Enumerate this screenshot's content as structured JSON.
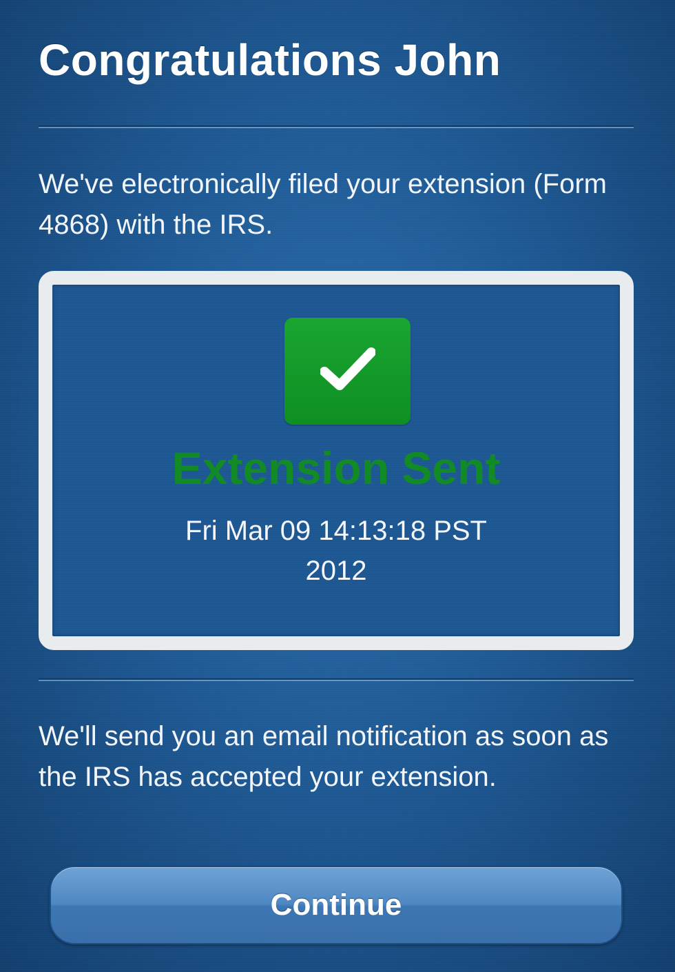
{
  "header": {
    "title": "Congratulations John"
  },
  "intro": {
    "text": "We've electronically filed your extension (Form 4868) with the IRS."
  },
  "status": {
    "icon": "checkmark-icon",
    "label": "Extension Sent",
    "date_line1": "Fri Mar 09 14:13:18 PST",
    "date_line2": "2012",
    "colors": {
      "badge": "#15a02c",
      "label": "#128a25"
    }
  },
  "notice": {
    "text": "We'll send you an email notification as soon as the IRS has accepted your extension."
  },
  "actions": {
    "continue_label": "Continue"
  }
}
